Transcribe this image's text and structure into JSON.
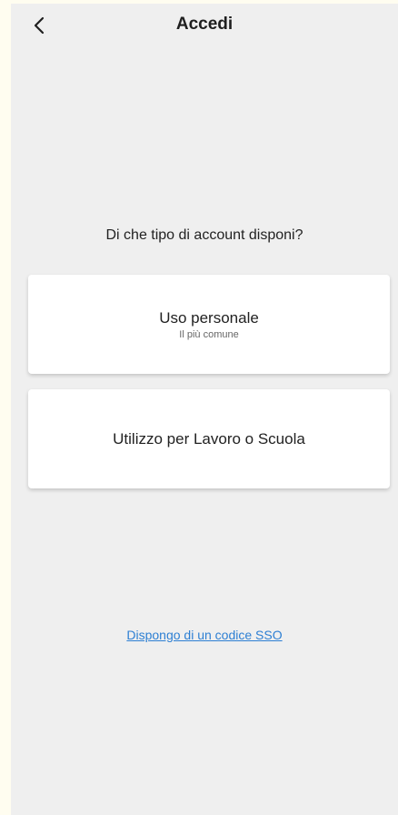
{
  "header": {
    "title": "Accedi",
    "back_icon": "chevron-left-icon"
  },
  "prompt": {
    "question": "Di che tipo di account disponi?"
  },
  "options": [
    {
      "label": "Uso personale",
      "sublabel": "Il più comune"
    },
    {
      "label": "Utilizzo per Lavoro o Scuola"
    }
  ],
  "footer": {
    "sso_link": "Dispongo di un codice SSO"
  },
  "colors": {
    "page_background": "#efefef",
    "outer_background": "#fffdf0",
    "card_background": "#ffffff",
    "link": "#2d7fd3"
  }
}
